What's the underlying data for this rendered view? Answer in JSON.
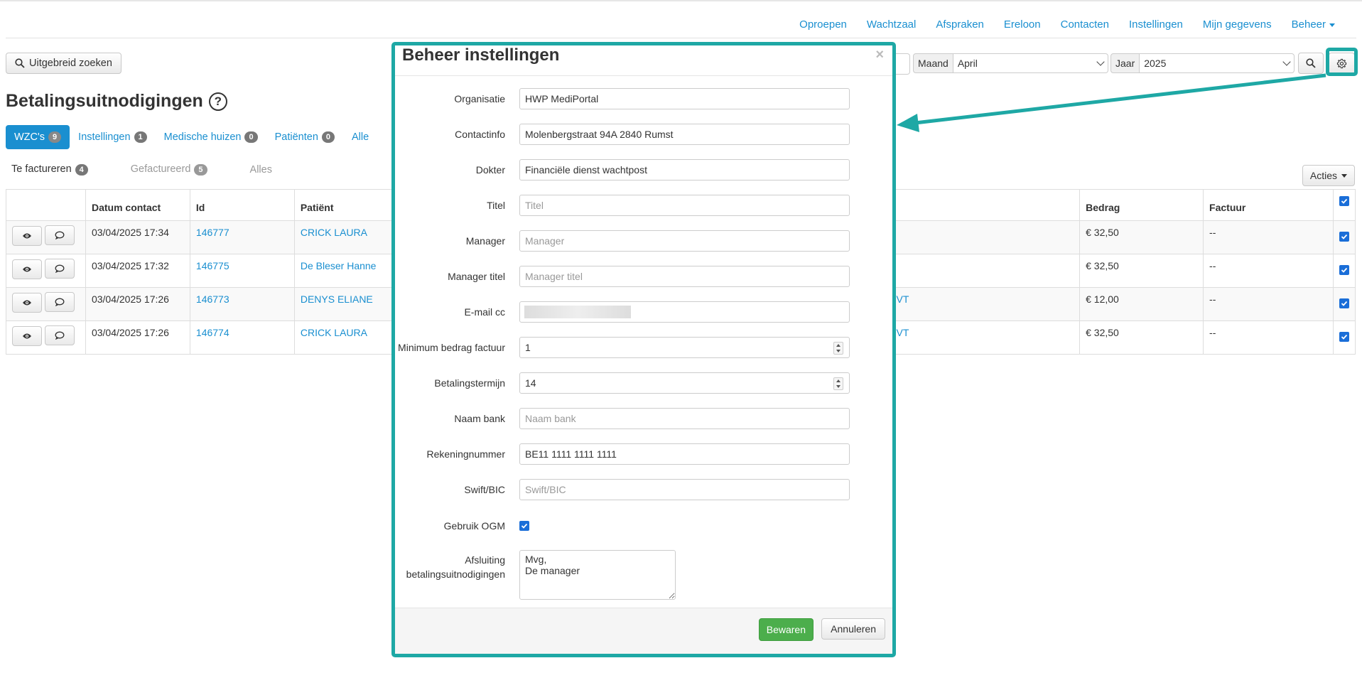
{
  "nav": {
    "items": [
      "Oproepen",
      "Wachtzaal",
      "Afspraken",
      "Ereloon",
      "Contacten",
      "Instellingen",
      "Mijn gegevens",
      "Beheer"
    ]
  },
  "toolbar": {
    "advanced_search": "Uitgebreid zoeken",
    "month_label": "Maand",
    "month_value": "April",
    "year_label": "Jaar",
    "year_value": "2025",
    "search_icon": "search-icon",
    "settings_icon": "gear-icon"
  },
  "page": {
    "title": "Betalingsuitnodigingen",
    "help_symbol": "?"
  },
  "pills": [
    {
      "label": "WZC's",
      "count": "9",
      "active": true
    },
    {
      "label": "Instellingen",
      "count": "1"
    },
    {
      "label": "Medische huizen",
      "count": "0"
    },
    {
      "label": "Patiënten",
      "count": "0"
    },
    {
      "label": "Alle"
    }
  ],
  "subtabs": [
    {
      "label": "Te factureren",
      "count": "4"
    },
    {
      "label": "Gefactureerd",
      "count": "5"
    },
    {
      "label": "Alles"
    }
  ],
  "actions_button": "Acties",
  "table": {
    "headers": [
      "",
      "Datum contact",
      "Id",
      "Patiënt",
      "Bedrag",
      "Factuur"
    ],
    "rows": [
      {
        "date": "03/04/2025 17:34",
        "id": "146777",
        "patient": "CRICK LAURA",
        "mid": "",
        "amount": "€ 32,50",
        "invoice": "--"
      },
      {
        "date": "03/04/2025 17:32",
        "id": "146775",
        "patient": "De Bleser Hanne",
        "mid": "",
        "amount": "€ 32,50",
        "invoice": "--"
      },
      {
        "date": "03/04/2025 17:26",
        "id": "146773",
        "patient": "DENYS ELIANE",
        "mid": "VT",
        "amount": "€ 12,00",
        "invoice": "--"
      },
      {
        "date": "03/04/2025 17:26",
        "id": "146774",
        "patient": "CRICK LAURA",
        "mid": "VT",
        "amount": "€ 32,50",
        "invoice": "--"
      }
    ]
  },
  "modal": {
    "title": "Beheer instellingen",
    "close": "×",
    "fields": {
      "organisatie": {
        "label": "Organisatie",
        "value": "HWP MediPortal"
      },
      "contactinfo": {
        "label": "Contactinfo",
        "value": "Molenbergstraat 94A 2840 Rumst"
      },
      "dokter": {
        "label": "Dokter",
        "value": "Financiële dienst wachtpost"
      },
      "titel": {
        "label": "Titel",
        "placeholder": "Titel"
      },
      "manager": {
        "label": "Manager",
        "placeholder": "Manager"
      },
      "manager_titel": {
        "label": "Manager titel",
        "placeholder": "Manager titel"
      },
      "email_cc": {
        "label": "E-mail cc"
      },
      "minimum_bedrag": {
        "label": "Minimum bedrag factuur",
        "value": "1"
      },
      "betalingstermijn": {
        "label": "Betalingstermijn",
        "value": "14"
      },
      "naam_bank": {
        "label": "Naam bank",
        "placeholder": "Naam bank"
      },
      "rekeningnummer": {
        "label": "Rekeningnummer",
        "value": "BE11 1111 1111 1111"
      },
      "swift": {
        "label": "Swift/BIC",
        "placeholder": "Swift/BIC"
      },
      "gebruik_ogm": {
        "label": "Gebruik OGM",
        "checked": true
      },
      "afsluiting": {
        "label_line1": "Afsluiting",
        "label_line2": "betalingsuitnodigingen",
        "value": "Mvg,\nDe manager"
      }
    },
    "save": "Bewaren",
    "cancel": "Annuleren"
  },
  "colors": {
    "link": "#1a8fd0",
    "highlight": "#1ea8a5",
    "save": "#4cae4c",
    "checkbox": "#1a6ed8"
  }
}
